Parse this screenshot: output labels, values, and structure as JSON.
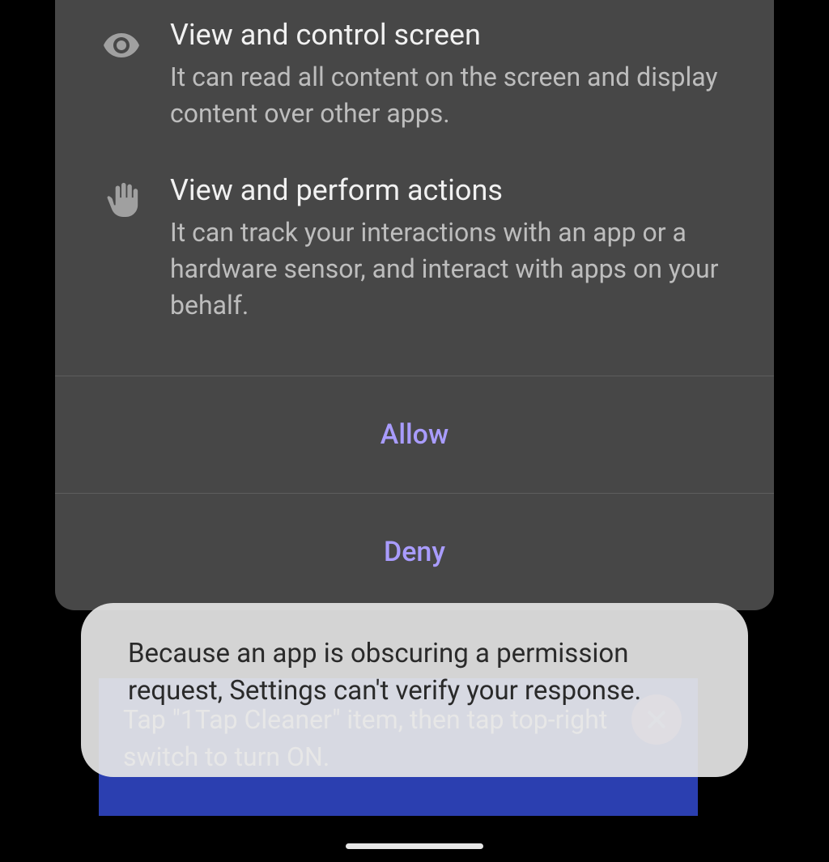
{
  "permissions": [
    {
      "icon": "eye-icon",
      "title": "View and control screen",
      "desc": "It can read all content on the screen and display content over other apps."
    },
    {
      "icon": "hand-icon",
      "title": "View and perform actions",
      "desc": "It can track your interactions with an app or a hardware sensor, and interact with apps on your behalf."
    }
  ],
  "buttons": {
    "allow": "Allow",
    "deny": "Deny"
  },
  "overlay_hint": "Tap \"1Tap Cleaner\" item, then tap top-right switch to turn ON.",
  "toast_message": "Because an app is obscuring a permission request, Settings can't verify your response."
}
